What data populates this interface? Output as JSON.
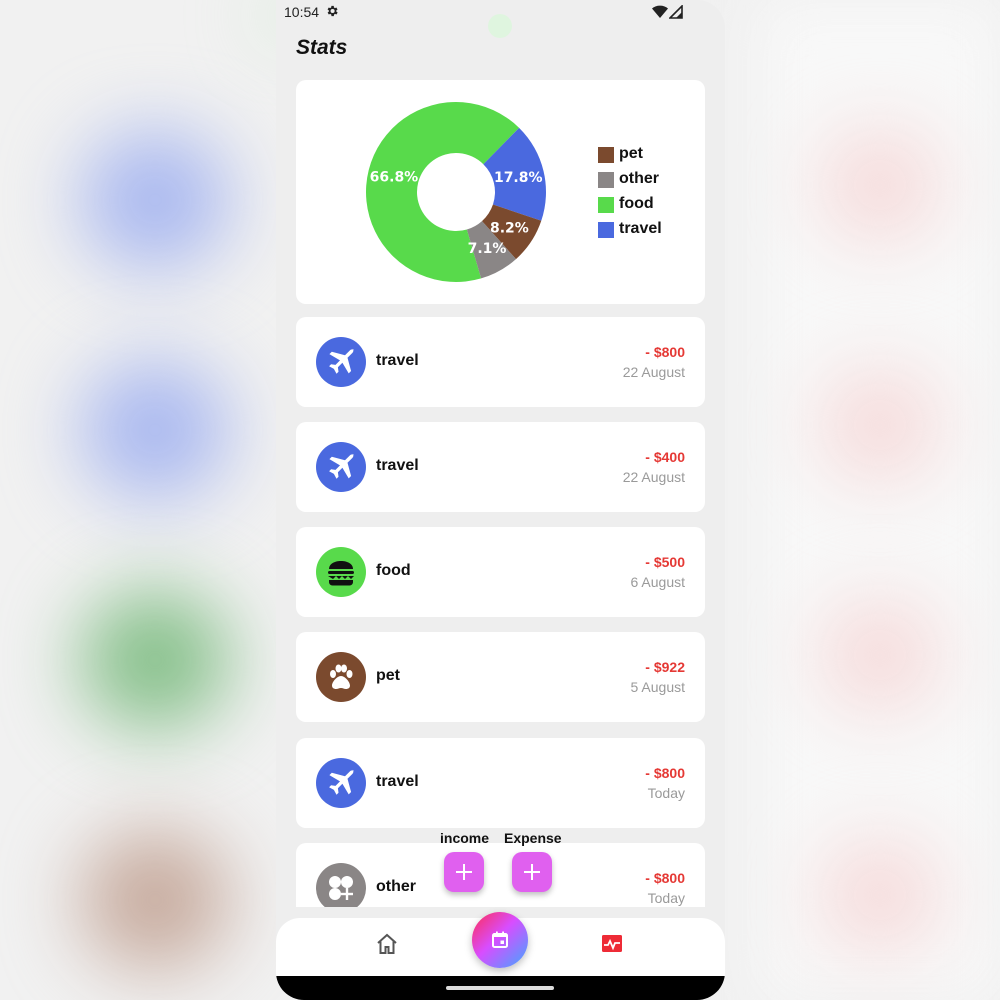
{
  "status_bar": {
    "time": "10:54"
  },
  "page": {
    "title": "Stats"
  },
  "chart_data": {
    "type": "pie",
    "categories": [
      "food",
      "travel",
      "pet",
      "other"
    ],
    "values": [
      66.8,
      17.8,
      8.2,
      7.1
    ],
    "labels": [
      "66.8%",
      "17.8%",
      "8.2%",
      "7.1%"
    ],
    "colors": [
      "#58da4b",
      "#4a69df",
      "#7b4a2e",
      "#8a8686"
    ],
    "legend": [
      "pet",
      "other",
      "food",
      "travel"
    ],
    "legend_colors": [
      "#7b4a2e",
      "#8a8686",
      "#58da4b",
      "#4a69df"
    ],
    "legend_position": "right"
  },
  "transactions": [
    {
      "category": "travel",
      "amount": "- $800",
      "date": "22 August",
      "icon": "airplane-icon",
      "color": "#4a69df"
    },
    {
      "category": "travel",
      "amount": "- $400",
      "date": "22 August",
      "icon": "airplane-icon",
      "color": "#4a69df"
    },
    {
      "category": "food",
      "amount": "- $500",
      "date": "6 August",
      "icon": "burger-icon",
      "color": "#58da4b"
    },
    {
      "category": "pet",
      "amount": "- $922",
      "date": "5 August",
      "icon": "paw-icon",
      "color": "#7b4a2e"
    },
    {
      "category": "travel",
      "amount": "- $800",
      "date": "Today",
      "icon": "airplane-icon",
      "color": "#4a69df"
    },
    {
      "category": "other",
      "amount": "- $800",
      "date": "Today",
      "icon": "category-add-icon",
      "color": "#8a8686"
    }
  ],
  "fab": {
    "income_label": "income",
    "expense_label": "Expense"
  },
  "icons": [
    "gear-icon",
    "wifi-icon",
    "signal-icon",
    "home-icon",
    "calendar-icon",
    "stats-icon",
    "plus-icon"
  ],
  "colors": {
    "accent": "#e060ef",
    "negative": "#e53935"
  }
}
